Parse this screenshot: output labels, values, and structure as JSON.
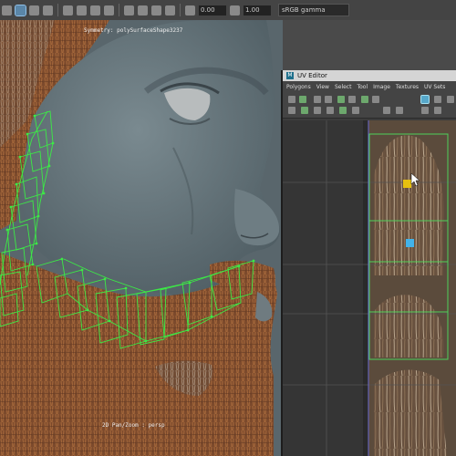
{
  "toolbar": {
    "field_a": "0.00",
    "field_b": "1.00",
    "color_space": "sRGB gamma"
  },
  "viewport": {
    "symmetry_label": "Symmetry: polySurfaceShape3237",
    "camera_label": "2D Pan/Zoom : persp"
  },
  "uv_editor": {
    "title": "UV Editor",
    "menu": [
      "Polygons",
      "View",
      "Select",
      "Tool",
      "Image",
      "Textures",
      "UV Sets"
    ],
    "selected_uv_color": "#e6c10f",
    "cursor_uv_color": "#42b3ea"
  },
  "colors": {
    "wireframe": "#3cea46",
    "uv_frame": "#4ed05a",
    "skin": "#6b7a80",
    "beard": "#8a5030"
  }
}
